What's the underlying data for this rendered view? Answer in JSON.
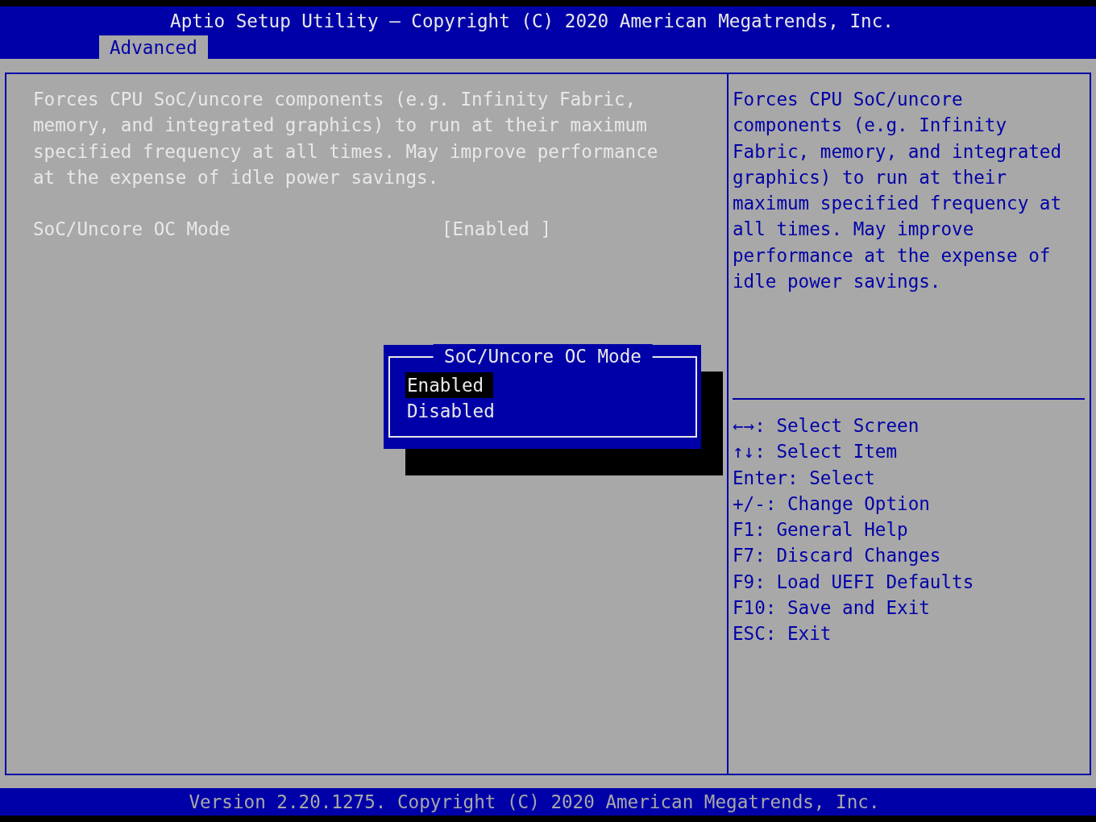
{
  "header": {
    "title": "Aptio Setup Utility – Copyright (C) 2020 American Megatrends, Inc."
  },
  "tabs": [
    {
      "label": "Advanced",
      "selected": true
    }
  ],
  "main": {
    "description": "Forces CPU SoC/uncore components (e.g. Infinity Fabric, memory, and integrated graphics) to run at their maximum specified frequency at all times. May improve performance at the expense of idle power savings.",
    "settings": [
      {
        "label": "SoC/Uncore OC Mode",
        "value": "[Enabled ]",
        "selected": true
      }
    ]
  },
  "help": {
    "text": "Forces CPU SoC/uncore components (e.g. Infinity Fabric, memory, and integrated graphics) to run at their maximum specified frequency at all times. May improve performance at the expense of idle power savings.",
    "keys": [
      "←→: Select Screen",
      "↑↓: Select Item",
      "Enter: Select",
      "+/-: Change Option",
      "F1: General Help",
      "F7: Discard Changes",
      "F9: Load UEFI Defaults",
      "F10: Save and Exit",
      "ESC: Exit"
    ]
  },
  "popup": {
    "title": "SoC/Uncore OC Mode",
    "options": [
      {
        "label": "Enabled",
        "selected": true
      },
      {
        "label": "Disabled",
        "selected": false
      }
    ]
  },
  "footer": {
    "text": "Version 2.20.1275. Copyright (C) 2020 American Megatrends, Inc."
  }
}
